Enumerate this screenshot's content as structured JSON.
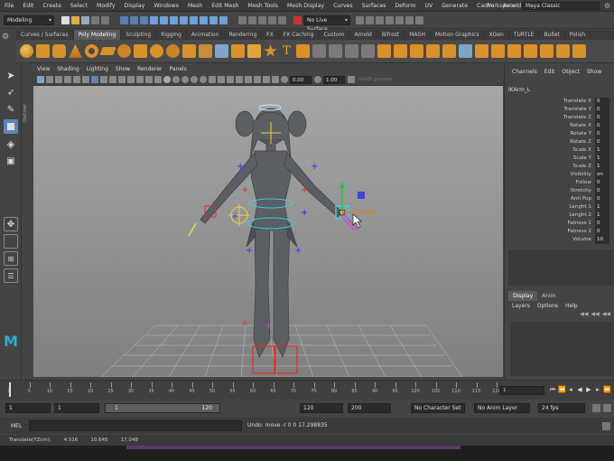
{
  "menubar": {
    "items": [
      "File",
      "Edit",
      "Create",
      "Select",
      "Modify",
      "Display",
      "Windows",
      "Mesh",
      "Edit Mesh",
      "Mesh Tools",
      "Mesh Display",
      "Curves",
      "Surfaces",
      "Deform",
      "UV",
      "Generate",
      "Cache",
      "Arnold",
      "Help"
    ],
    "workspace_label": "Workspace :",
    "workspace_value": "Maya Classic"
  },
  "statusline": {
    "menuset": "Modeling",
    "live_surface": "No Live Surface"
  },
  "shelf": {
    "tabs": [
      "Curves / Surfaces",
      "Poly Modeling",
      "Sculpting",
      "Rigging",
      "Animation",
      "Rendering",
      "FX",
      "FX Caching",
      "Custom",
      "Arnold",
      "Bifrost",
      "MASH",
      "Motion Graphics",
      "XGen",
      "TURTLE",
      "Bullet",
      "Polish"
    ],
    "active_tab": "Poly Modeling"
  },
  "panel": {
    "menu": [
      "View",
      "Shading",
      "Lighting",
      "Show",
      "Renderer",
      "Panels"
    ],
    "near_value": "0.00",
    "far_value": "1.00",
    "color_space": "sRGB gamma",
    "outliner_label": "Outliner"
  },
  "channelbox": {
    "menu": [
      "Channels",
      "Edit",
      "Object",
      "Show"
    ],
    "object_name": "IKArm_L",
    "attributes": [
      {
        "name": "Translate X",
        "value": "0"
      },
      {
        "name": "Translate Y",
        "value": "0"
      },
      {
        "name": "Translate Z",
        "value": "0"
      },
      {
        "name": "Rotate X",
        "value": "0"
      },
      {
        "name": "Rotate Y",
        "value": "0"
      },
      {
        "name": "Rotate Z",
        "value": "0"
      },
      {
        "name": "Scale X",
        "value": "1"
      },
      {
        "name": "Scale Y",
        "value": "1"
      },
      {
        "name": "Scale Z",
        "value": "1"
      },
      {
        "name": "Visibility",
        "value": "on"
      },
      {
        "name": "Follow",
        "value": "0"
      },
      {
        "name": "Stretchy",
        "value": "0"
      },
      {
        "name": "Anti Pop",
        "value": "0"
      },
      {
        "name": "Lenght 1",
        "value": "1"
      },
      {
        "name": "Lenght 2",
        "value": "1"
      },
      {
        "name": "Fatness 1",
        "value": "0"
      },
      {
        "name": "Fatness 2",
        "value": "0"
      },
      {
        "name": "Volume",
        "value": "10"
      }
    ]
  },
  "layereditor": {
    "tabs": [
      "Display",
      "Anim"
    ],
    "active_tab": "Display",
    "menu": [
      "Layers",
      "Options",
      "Help"
    ]
  },
  "timeslider": {
    "ticks": [
      "1",
      "5",
      "10",
      "15",
      "20",
      "25",
      "30",
      "35",
      "40",
      "45",
      "50",
      "55",
      "60",
      "65",
      "70",
      "75",
      "80",
      "85",
      "90",
      "95",
      "100",
      "105",
      "110",
      "115",
      "120"
    ],
    "current_frame": "1"
  },
  "rangeslider": {
    "start_time": "1",
    "playback_start": "1",
    "range_start": "1",
    "range_end": "120",
    "playback_end": "120",
    "end_time": "200",
    "character_set": "No Character Set",
    "anim_layer": "No Anim Layer",
    "fps": "24 fps"
  },
  "cmdline": {
    "language": "MEL",
    "result": "Undo: move -r 0 0 17.298835"
  },
  "helpline": {
    "label": "Translate(YZcm):",
    "x": "4.516",
    "y": "10.645",
    "z": "17.048"
  },
  "colors": {
    "accent_active_tab": "#5a5a5a",
    "viewport_bg": "#9a9a9a",
    "ik_yellow": "#f0d040",
    "ik_red": "#e03020",
    "ik_cyan": "#40d0e0",
    "ik_blue": "#2030ff",
    "maya_logo": "#2ab0d8"
  }
}
